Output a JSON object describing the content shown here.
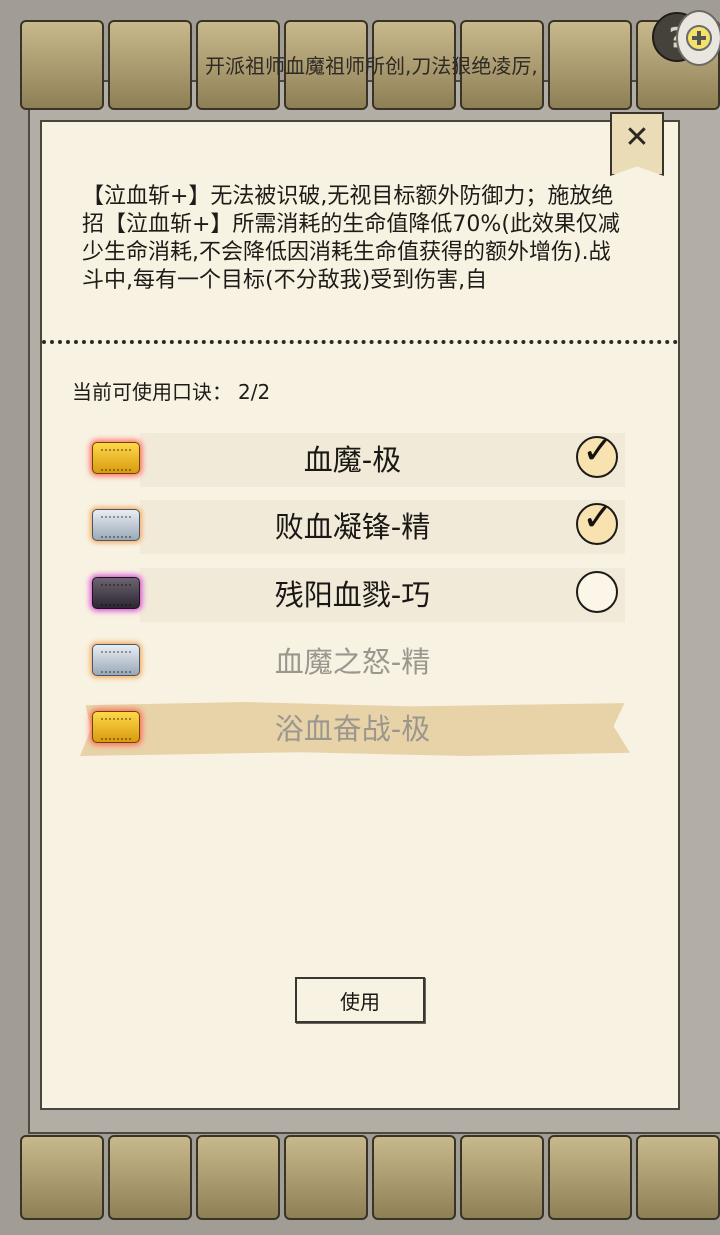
{
  "background": {
    "scroll_text": "开派祖师血魔祖师所创,刀法狠绝凌厉,"
  },
  "help_label": "?",
  "close_label": "✕",
  "description": "【泣血斩+】无法被识破,无视目标额外防御力；施放绝招【泣血斩+】所需消耗的生命值降低70%(此效果仅减少生命消耗,不会降低因消耗生命值获得的额外增伤).战斗中,每有一个目标(不分敌我)受到伤害,自",
  "count_label": "当前可使用口诀：",
  "count_value": "2/2",
  "formulas": [
    {
      "name": "血魔-极",
      "token": "gold-token-icon",
      "checked": true,
      "enabled": true
    },
    {
      "name": "败血凝锋-精",
      "token": "silver-token-icon",
      "checked": true,
      "enabled": true
    },
    {
      "name": "残阳血戮-巧",
      "token": "dark-token-icon",
      "checked": false,
      "enabled": true
    },
    {
      "name": "血魔之怒-精",
      "token": "silver-token-icon",
      "checked": false,
      "enabled": false
    },
    {
      "name": "浴血奋战-极",
      "token": "gold-token-icon",
      "checked": false,
      "enabled": false,
      "selected": true
    }
  ],
  "use_button_label": "使用",
  "colors": {
    "panel": "#f8f2e2",
    "highlight": "#e8d3a8",
    "disabled_text": "#9b978f"
  }
}
